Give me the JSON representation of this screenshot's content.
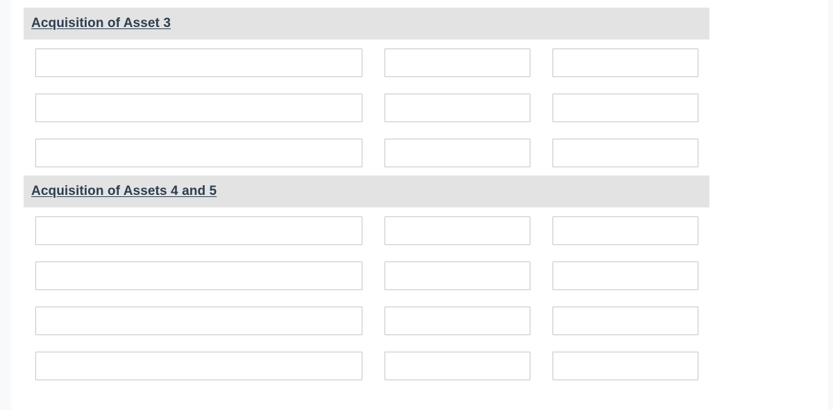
{
  "page": {
    "background_color": "#f8f9fa",
    "card_background_color": "#ffffff"
  },
  "theme": {
    "header_bar_color": "#e3e3e3",
    "header_text_color": "#2c3e50",
    "field_border_color": "#cccccc",
    "field_background_color": "#ffffff"
  },
  "form": {
    "sections": [
      {
        "id": "acquisition-of-asset-3",
        "title": "Acquisition of Asset 3",
        "rows": [
          {
            "fields": [
              {
                "name": "asset3-row1-field1",
                "value": "",
                "placeholder": ""
              },
              {
                "name": "asset3-row1-field2",
                "value": "",
                "placeholder": ""
              },
              {
                "name": "asset3-row1-field3",
                "value": "",
                "placeholder": ""
              }
            ]
          },
          {
            "fields": [
              {
                "name": "asset3-row2-field1",
                "value": "",
                "placeholder": ""
              },
              {
                "name": "asset3-row2-field2",
                "value": "",
                "placeholder": ""
              },
              {
                "name": "asset3-row2-field3",
                "value": "",
                "placeholder": ""
              }
            ]
          },
          {
            "fields": [
              {
                "name": "asset3-row3-field1",
                "value": "",
                "placeholder": ""
              },
              {
                "name": "asset3-row3-field2",
                "value": "",
                "placeholder": ""
              },
              {
                "name": "asset3-row3-field3",
                "value": "",
                "placeholder": ""
              }
            ]
          }
        ]
      },
      {
        "id": "acquisition-of-assets-4-and-5",
        "title": "Acquisition of Assets 4 and 5",
        "rows": [
          {
            "fields": [
              {
                "name": "assets45-row1-field1",
                "value": "",
                "placeholder": ""
              },
              {
                "name": "assets45-row1-field2",
                "value": "",
                "placeholder": ""
              },
              {
                "name": "assets45-row1-field3",
                "value": "",
                "placeholder": ""
              }
            ]
          },
          {
            "fields": [
              {
                "name": "assets45-row2-field1",
                "value": "",
                "placeholder": ""
              },
              {
                "name": "assets45-row2-field2",
                "value": "",
                "placeholder": ""
              },
              {
                "name": "assets45-row2-field3",
                "value": "",
                "placeholder": ""
              }
            ]
          },
          {
            "fields": [
              {
                "name": "assets45-row3-field1",
                "value": "",
                "placeholder": ""
              },
              {
                "name": "assets45-row3-field2",
                "value": "",
                "placeholder": ""
              },
              {
                "name": "assets45-row3-field3",
                "value": "",
                "placeholder": ""
              }
            ]
          },
          {
            "fields": [
              {
                "name": "assets45-row4-field1",
                "value": "",
                "placeholder": ""
              },
              {
                "name": "assets45-row4-field2",
                "value": "",
                "placeholder": ""
              },
              {
                "name": "assets45-row4-field3",
                "value": "",
                "placeholder": ""
              }
            ]
          }
        ]
      }
    ]
  }
}
